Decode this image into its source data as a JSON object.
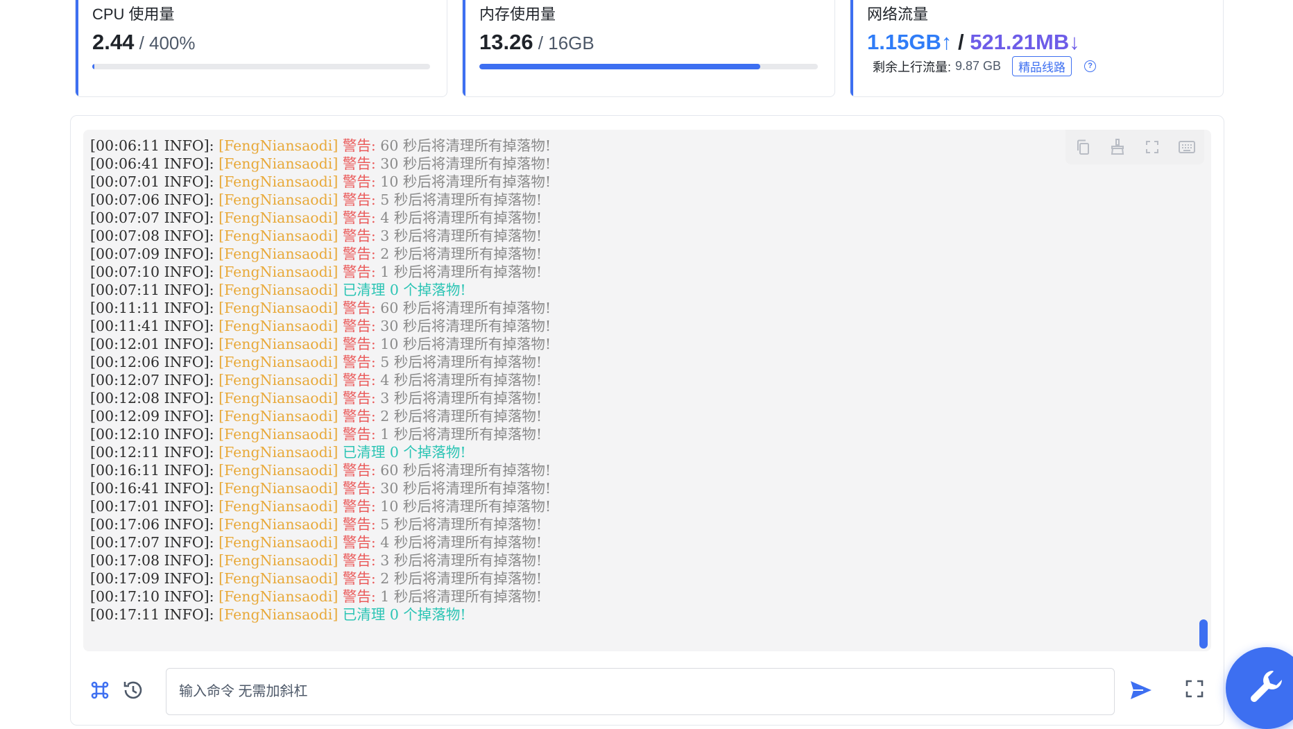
{
  "cards": {
    "cpu": {
      "title": "CPU 使用量",
      "value": "2.44",
      "unit": " / 400%",
      "usage_fraction": 0.006
    },
    "memory": {
      "title": "内存使用量",
      "value": "13.26",
      "unit": " / 16GB",
      "usage_fraction": 0.829
    },
    "network": {
      "title": "网络流量",
      "up": "1.15GB↑",
      "separator": " / ",
      "down": "521.21MB↓",
      "remaining_label": "剩余上行流量:",
      "remaining_value": "9.87 GB",
      "badge": "精品线路",
      "help": "?"
    }
  },
  "colors": {
    "accent": "#3d6ff1",
    "tag": "#e8a93a",
    "warn": "#ea5a5a",
    "ok": "#2bc4b4"
  },
  "terminal": {
    "toolbar": [
      "copy-icon",
      "clear-broom-icon",
      "fullscreen-icon",
      "keyboard-icon"
    ],
    "lines": [
      {
        "time": "[00:06:11 INFO]: ",
        "tag": "[FengNiansaodi] ",
        "warn": "警告: ",
        "msg": "60 秒后将清理所有掉落物!",
        "ok": ""
      },
      {
        "time": "[00:06:41 INFO]: ",
        "tag": "[FengNiansaodi] ",
        "warn": "警告: ",
        "msg": "30 秒后将清理所有掉落物!",
        "ok": ""
      },
      {
        "time": "[00:07:01 INFO]: ",
        "tag": "[FengNiansaodi] ",
        "warn": "警告: ",
        "msg": "10 秒后将清理所有掉落物!",
        "ok": ""
      },
      {
        "time": "[00:07:06 INFO]: ",
        "tag": "[FengNiansaodi] ",
        "warn": "警告: ",
        "msg": "5 秒后将清理所有掉落物!",
        "ok": ""
      },
      {
        "time": "[00:07:07 INFO]: ",
        "tag": "[FengNiansaodi] ",
        "warn": "警告: ",
        "msg": "4 秒后将清理所有掉落物!",
        "ok": ""
      },
      {
        "time": "[00:07:08 INFO]: ",
        "tag": "[FengNiansaodi] ",
        "warn": "警告: ",
        "msg": "3 秒后将清理所有掉落物!",
        "ok": ""
      },
      {
        "time": "[00:07:09 INFO]: ",
        "tag": "[FengNiansaodi] ",
        "warn": "警告: ",
        "msg": "2 秒后将清理所有掉落物!",
        "ok": ""
      },
      {
        "time": "[00:07:10 INFO]: ",
        "tag": "[FengNiansaodi] ",
        "warn": "警告: ",
        "msg": "1 秒后将清理所有掉落物!",
        "ok": ""
      },
      {
        "time": "[00:07:11 INFO]: ",
        "tag": "[FengNiansaodi] ",
        "warn": "",
        "msg": "",
        "ok": "已清理 0 个掉落物!"
      },
      {
        "time": "[00:11:11 INFO]: ",
        "tag": "[FengNiansaodi] ",
        "warn": "警告: ",
        "msg": "60 秒后将清理所有掉落物!",
        "ok": ""
      },
      {
        "time": "[00:11:41 INFO]: ",
        "tag": "[FengNiansaodi] ",
        "warn": "警告: ",
        "msg": "30 秒后将清理所有掉落物!",
        "ok": ""
      },
      {
        "time": "[00:12:01 INFO]: ",
        "tag": "[FengNiansaodi] ",
        "warn": "警告: ",
        "msg": "10 秒后将清理所有掉落物!",
        "ok": ""
      },
      {
        "time": "[00:12:06 INFO]: ",
        "tag": "[FengNiansaodi] ",
        "warn": "警告: ",
        "msg": "5 秒后将清理所有掉落物!",
        "ok": ""
      },
      {
        "time": "[00:12:07 INFO]: ",
        "tag": "[FengNiansaodi] ",
        "warn": "警告: ",
        "msg": "4 秒后将清理所有掉落物!",
        "ok": ""
      },
      {
        "time": "[00:12:08 INFO]: ",
        "tag": "[FengNiansaodi] ",
        "warn": "警告: ",
        "msg": "3 秒后将清理所有掉落物!",
        "ok": ""
      },
      {
        "time": "[00:12:09 INFO]: ",
        "tag": "[FengNiansaodi] ",
        "warn": "警告: ",
        "msg": "2 秒后将清理所有掉落物!",
        "ok": ""
      },
      {
        "time": "[00:12:10 INFO]: ",
        "tag": "[FengNiansaodi] ",
        "warn": "警告: ",
        "msg": "1 秒后将清理所有掉落物!",
        "ok": ""
      },
      {
        "time": "[00:12:11 INFO]: ",
        "tag": "[FengNiansaodi] ",
        "warn": "",
        "msg": "",
        "ok": "已清理 0 个掉落物!"
      },
      {
        "time": "[00:16:11 INFO]: ",
        "tag": "[FengNiansaodi] ",
        "warn": "警告: ",
        "msg": "60 秒后将清理所有掉落物!",
        "ok": ""
      },
      {
        "time": "[00:16:41 INFO]: ",
        "tag": "[FengNiansaodi] ",
        "warn": "警告: ",
        "msg": "30 秒后将清理所有掉落物!",
        "ok": ""
      },
      {
        "time": "[00:17:01 INFO]: ",
        "tag": "[FengNiansaodi] ",
        "warn": "警告: ",
        "msg": "10 秒后将清理所有掉落物!",
        "ok": ""
      },
      {
        "time": "[00:17:06 INFO]: ",
        "tag": "[FengNiansaodi] ",
        "warn": "警告: ",
        "msg": "5 秒后将清理所有掉落物!",
        "ok": ""
      },
      {
        "time": "[00:17:07 INFO]: ",
        "tag": "[FengNiansaodi] ",
        "warn": "警告: ",
        "msg": "4 秒后将清理所有掉落物!",
        "ok": ""
      },
      {
        "time": "[00:17:08 INFO]: ",
        "tag": "[FengNiansaodi] ",
        "warn": "警告: ",
        "msg": "3 秒后将清理所有掉落物!",
        "ok": ""
      },
      {
        "time": "[00:17:09 INFO]: ",
        "tag": "[FengNiansaodi] ",
        "warn": "警告: ",
        "msg": "2 秒后将清理所有掉落物!",
        "ok": ""
      },
      {
        "time": "[00:17:10 INFO]: ",
        "tag": "[FengNiansaodi] ",
        "warn": "警告: ",
        "msg": "1 秒后将清理所有掉落物!",
        "ok": ""
      },
      {
        "time": "[00:17:11 INFO]: ",
        "tag": "[FengNiansaodi] ",
        "warn": "",
        "msg": "",
        "ok": "已清理 0 个掉落物!"
      }
    ]
  },
  "command": {
    "placeholder": "输入命令 无需加斜杠",
    "value": "",
    "icons": [
      "command-icon",
      "history-icon",
      "send-icon",
      "fullscreen-icon"
    ]
  },
  "fab": {
    "icon": "wrench-icon"
  }
}
